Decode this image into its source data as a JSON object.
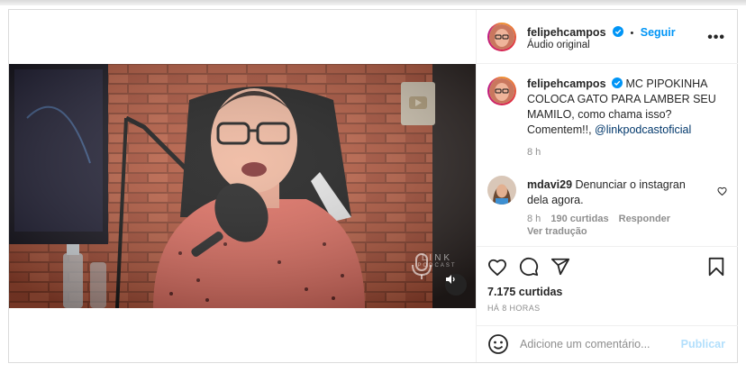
{
  "post": {
    "author": "felipehcampos",
    "follow_label": "Seguir",
    "separator": "•",
    "audio_label": "Áudio original",
    "more_label": "•••",
    "caption": {
      "username": "felipehcampos",
      "text": "MC PIPOKINHA COLOCA GATO PARA LAMBER SEU MAMILO, como chama isso? Comentem!!,",
      "mention": "@linkpodcastoficial",
      "time": "8 h"
    },
    "comments": [
      {
        "username": "mdavi29",
        "text": "Denunciar o instagran dela agora.",
        "time": "8 h",
        "likes": "190 curtidas",
        "reply_label": "Responder",
        "translate_label": "Ver tradução"
      }
    ],
    "likes": "7.175 curtidas",
    "time_ago": "HÁ 8 HORAS",
    "add_comment_placeholder": "Adicione um comentário...",
    "publish_label": "Publicar",
    "watermark": "LINK",
    "watermark_sub": "PODCAST"
  },
  "icons": {
    "like": "heart-icon",
    "comment": "comment-icon",
    "share": "share-icon",
    "save": "bookmark-icon",
    "emoji": "emoji-icon",
    "mute": "speaker-icon",
    "verified": "verified-icon",
    "comment_like": "small-heart-icon"
  },
  "colors": {
    "accent": "#0095f6",
    "publish_disabled": "#b2dffc",
    "mention": "#00376b",
    "muted_text": "#8e8e8e",
    "border": "#dbdbdb"
  }
}
